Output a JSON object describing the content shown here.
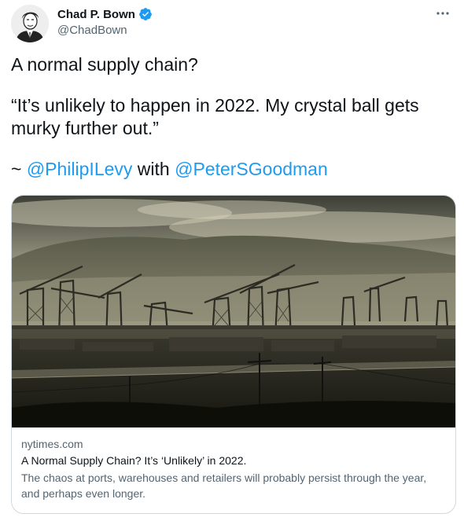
{
  "author": {
    "display_name": "Chad P. Bown",
    "handle": "@ChadBown",
    "avatar_icon": "portrait-avatar",
    "verified_icon": "verified-badge-icon",
    "verified_color": "#1d9bf0"
  },
  "more_icon": "more-horizontal-icon",
  "tweet": {
    "line1": "A normal supply chain?",
    "quote": "“It’s unlikely to happen in 2022. My crystal ball gets murky further out.”",
    "prefix": "~ ",
    "mention1": "@PhilipILevy",
    "connector": " with ",
    "mention2": "@PeterSGoodman",
    "mention_color": "#1d9bf0"
  },
  "card": {
    "image_icon": "port-cranes-photo",
    "domain": "nytimes.com",
    "title": "A Normal Supply Chain? It’s ‘Unlikely’ in 2022.",
    "description": "The chaos at ports, warehouses and retailers will probably persist through the year, and perhaps even longer."
  }
}
